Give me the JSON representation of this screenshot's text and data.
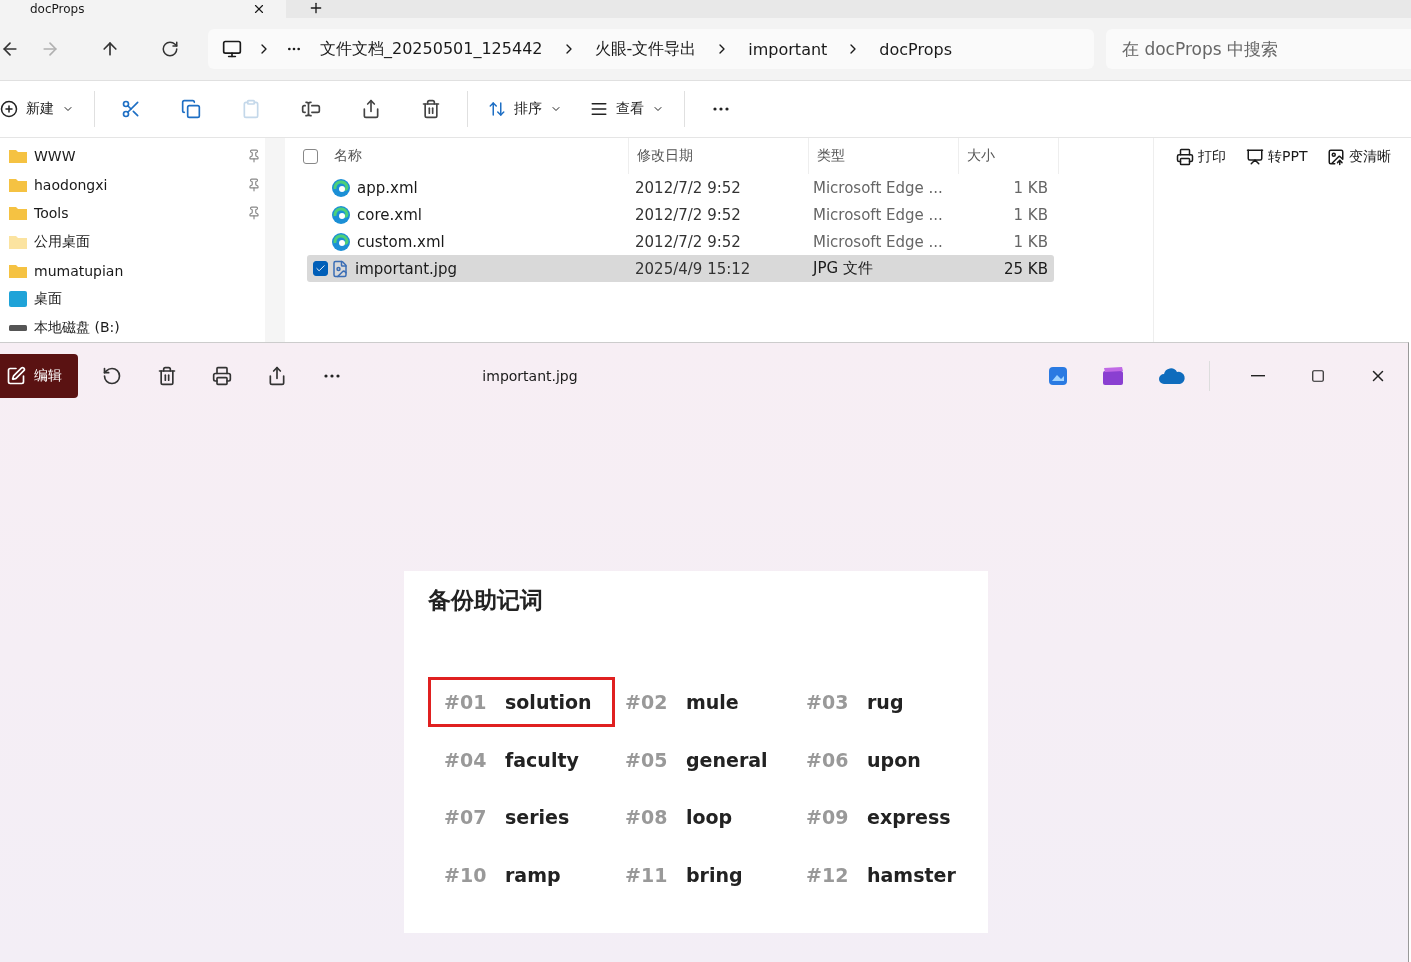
{
  "explorer": {
    "tab": {
      "title": "docProps"
    },
    "breadcrumb": [
      "文件文档_20250501_125442",
      "火眼-文件导出",
      "important",
      "docProps"
    ],
    "search": {
      "placeholder": "在 docProps 中搜索"
    },
    "new_menu": "新建",
    "tools": [
      {
        "kind": "cut",
        "disabled": false
      },
      {
        "kind": "copy",
        "disabled": false
      },
      {
        "kind": "paste",
        "disabled": true
      },
      {
        "kind": "rename",
        "disabled": false
      },
      {
        "kind": "share",
        "disabled": false
      },
      {
        "kind": "delete",
        "disabled": false
      }
    ],
    "sort_menu": "排序",
    "view_menu": "查看",
    "sidebar": [
      {
        "label": "WWW",
        "kind": "folder",
        "pinned": true
      },
      {
        "label": "haodongxi",
        "kind": "folder",
        "pinned": true
      },
      {
        "label": "Tools",
        "kind": "folder",
        "pinned": true
      },
      {
        "label": "公用桌面",
        "kind": "sharedfolder",
        "pinned": false
      },
      {
        "label": "mumatupian",
        "kind": "folder",
        "pinned": false
      },
      {
        "label": "桌面",
        "kind": "desktop",
        "pinned": false
      },
      {
        "label": "本地磁盘 (B:)",
        "kind": "drive",
        "pinned": false
      }
    ],
    "select_all": {
      "checked": false
    },
    "columns": [
      "名称",
      "修改日期",
      "类型",
      "大小"
    ],
    "rows": [
      {
        "name": "app.xml",
        "date": "2012/7/2 9:52",
        "type": "Microsoft Edge ...",
        "size": "1 KB",
        "kind": "edge",
        "selected": false
      },
      {
        "name": "core.xml",
        "date": "2012/7/2 9:52",
        "type": "Microsoft Edge ...",
        "size": "1 KB",
        "kind": "edge",
        "selected": false
      },
      {
        "name": "custom.xml",
        "date": "2012/7/2 9:52",
        "type": "Microsoft Edge ...",
        "size": "1 KB",
        "kind": "edge",
        "selected": false
      },
      {
        "name": "important.jpg",
        "date": "2025/4/9 15:12",
        "type": "JPG 文件",
        "size": "25 KB",
        "kind": "image",
        "selected": true
      }
    ],
    "actions": [
      {
        "kind": "print",
        "label": "打印"
      },
      {
        "kind": "ppt",
        "label": "转PPT"
      },
      {
        "kind": "enhance",
        "label": "变清晰"
      }
    ]
  },
  "viewer": {
    "edit": "编辑",
    "title": "important.jpg",
    "document": {
      "title": "备份助记词",
      "words": [
        {
          "index": "#01",
          "word": "solution",
          "highlighted": true
        },
        {
          "index": "#02",
          "word": "mule",
          "highlighted": false
        },
        {
          "index": "#03",
          "word": "rug",
          "highlighted": false
        },
        {
          "index": "#04",
          "word": "faculty",
          "highlighted": false
        },
        {
          "index": "#05",
          "word": "general",
          "highlighted": false
        },
        {
          "index": "#06",
          "word": "upon",
          "highlighted": false
        },
        {
          "index": "#07",
          "word": "series",
          "highlighted": false
        },
        {
          "index": "#08",
          "word": "loop",
          "highlighted": false
        },
        {
          "index": "#09",
          "word": "express",
          "highlighted": false
        },
        {
          "index": "#10",
          "word": "ramp",
          "highlighted": false
        },
        {
          "index": "#11",
          "word": "bring",
          "highlighted": false
        },
        {
          "index": "#12",
          "word": "hamster",
          "highlighted": false
        }
      ]
    }
  }
}
